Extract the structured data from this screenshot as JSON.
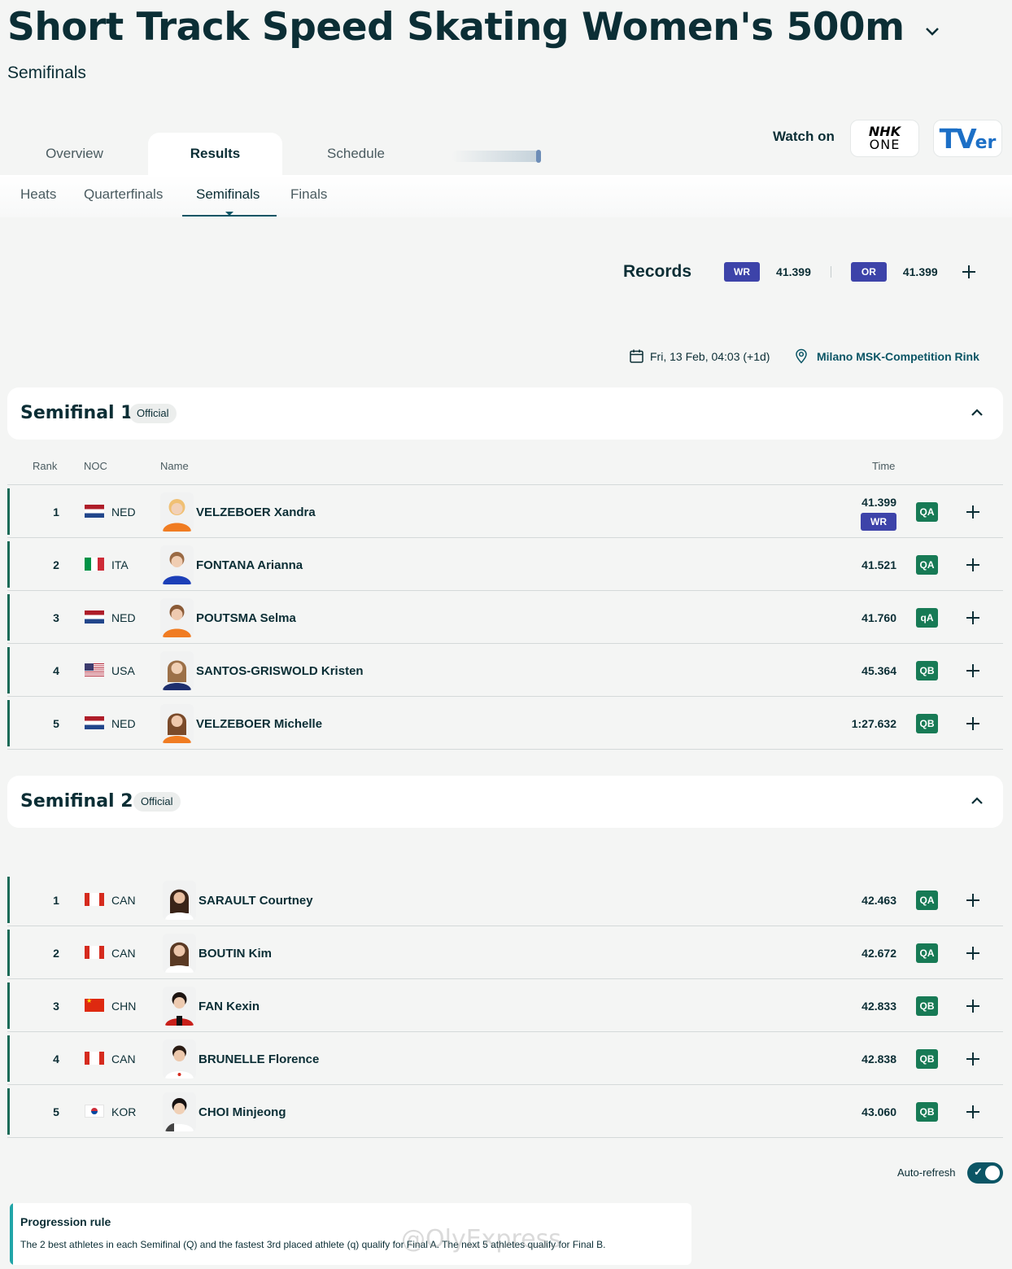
{
  "header": {
    "title": "Short Track Speed Skating Women's 500m",
    "subtitle": "Semifinals"
  },
  "tabs": [
    {
      "label": "Overview"
    },
    {
      "label": "Results"
    },
    {
      "label": "Schedule"
    }
  ],
  "watch": {
    "label": "Watch on",
    "nhk_line1": "NHK",
    "nhk_line2": "ONE",
    "tver_big": "TV",
    "tver_small": "er"
  },
  "subtabs": [
    {
      "label": "Heats"
    },
    {
      "label": "Quarterfinals"
    },
    {
      "label": "Semifinals"
    },
    {
      "label": "Finals"
    }
  ],
  "records": {
    "label": "Records",
    "wr_badge": "WR",
    "wr_value": "41.399",
    "or_badge": "OR",
    "or_value": "41.399"
  },
  "meta": {
    "datetime": "Fri, 13 Feb, 04:03 (+1d)",
    "venue": "Milano MSK-Competition Rink"
  },
  "columns": {
    "rank": "Rank",
    "noc": "NOC",
    "name": "Name",
    "time": "Time"
  },
  "heats": [
    {
      "title": "Semifinal 1",
      "status": "Official",
      "rows": [
        {
          "rank": "1",
          "noc": "NED",
          "name": "VELZEBOER Xandra",
          "time": "41.399",
          "record": "WR",
          "q": "QA"
        },
        {
          "rank": "2",
          "noc": "ITA",
          "name": "FONTANA Arianna",
          "time": "41.521",
          "q": "QA"
        },
        {
          "rank": "3",
          "noc": "NED",
          "name": "POUTSMA Selma",
          "time": "41.760",
          "q": "qA"
        },
        {
          "rank": "4",
          "noc": "USA",
          "name": "SANTOS-GRISWOLD Kristen",
          "time": "45.364",
          "q": "QB"
        },
        {
          "rank": "5",
          "noc": "NED",
          "name": "VELZEBOER Michelle",
          "time": "1:27.632",
          "q": "QB"
        }
      ]
    },
    {
      "title": "Semifinal 2",
      "status": "Official",
      "rows": [
        {
          "rank": "1",
          "noc": "CAN",
          "name": "SARAULT Courtney",
          "time": "42.463",
          "q": "QA"
        },
        {
          "rank": "2",
          "noc": "CAN",
          "name": "BOUTIN Kim",
          "time": "42.672",
          "q": "QA"
        },
        {
          "rank": "3",
          "noc": "CHN",
          "name": "FAN Kexin",
          "time": "42.833",
          "q": "QB"
        },
        {
          "rank": "4",
          "noc": "CAN",
          "name": "BRUNELLE Florence",
          "time": "42.838",
          "q": "QB"
        },
        {
          "rank": "5",
          "noc": "KOR",
          "name": "CHOI Minjeong",
          "time": "43.060",
          "q": "QB"
        }
      ]
    }
  ],
  "auto_refresh": {
    "label": "Auto-refresh",
    "enabled": true
  },
  "progression": {
    "title": "Progression rule",
    "text": "The 2 best athletes in each Semifinal (Q) and the fastest 3rd placed athlete (q) qualify for Final A. The next 5 athletes qualify for Final B."
  },
  "watermark": "@OlyExpress",
  "colors": {
    "primary": "#0b2e35",
    "record_badge": "#3d43a9",
    "qualify_badge": "#177a55",
    "row_accent": "#1a6a57",
    "toggle": "#0b5565"
  }
}
